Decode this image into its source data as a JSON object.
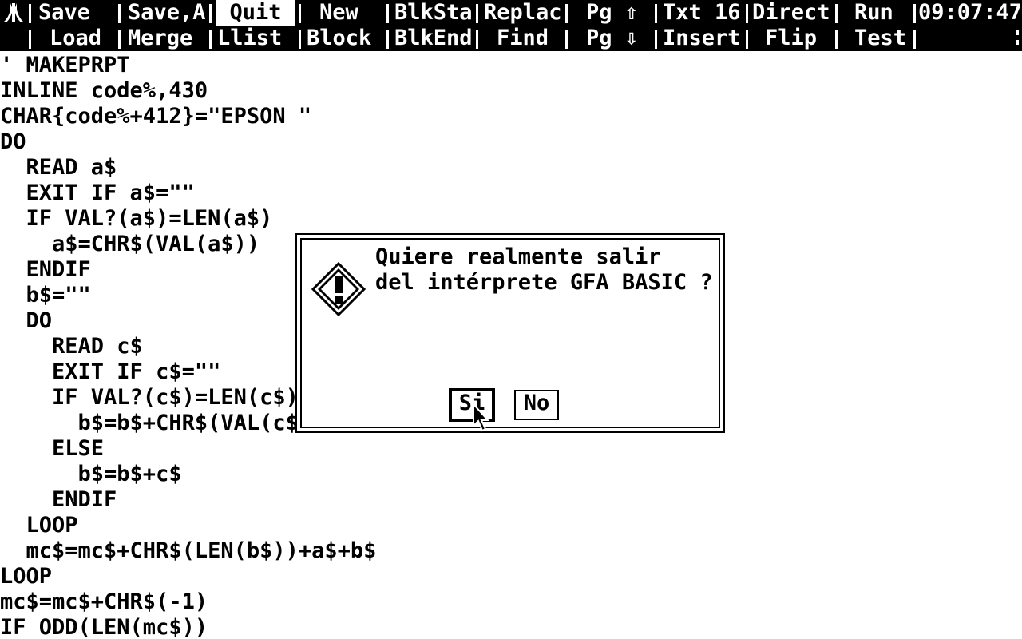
{
  "menubar": {
    "row1": [
      "Save",
      "Save,A",
      "Quit",
      "New",
      "BlkSta",
      "Replac",
      "Pg ⇧",
      "Txt 16",
      "Direct",
      "Run",
      "09:07:47"
    ],
    "row2": [
      "Load",
      "Merge",
      "Llist",
      "Block",
      "BlkEnd",
      "Find",
      "Pg ⇩",
      "Insert",
      "Flip",
      "Test"
    ],
    "selected": "Quit"
  },
  "code": [
    "' MAKEPRPT",
    "INLINE code%,430",
    "CHAR{code%+412}=\"EPSON \"",
    "DO",
    "  READ a$",
    "  EXIT IF a$=\"\"",
    "  IF VAL?(a$)=LEN(a$)",
    "    a$=CHR$(VAL(a$))",
    "  ENDIF",
    "  b$=\"\"",
    "  DO",
    "    READ c$",
    "    EXIT IF c$=\"\"",
    "    IF VAL?(c$)=LEN(c$)",
    "      b$=b$+CHR$(VAL(c$",
    "    ELSE",
    "      b$=b$+c$",
    "    ENDIF",
    "  LOOP",
    "  mc$=mc$+CHR$(LEN(b$))+a$+b$",
    "LOOP",
    "mc$=mc$+CHR$(-1)",
    "IF ODD(LEN(mc$))"
  ],
  "alert": {
    "icon": "exclamation-icon",
    "lines": [
      "Quiere realmente salir",
      "del intérprete GFA BASIC ?"
    ],
    "buttons": [
      "Si",
      "No"
    ],
    "default_button": "Si"
  }
}
